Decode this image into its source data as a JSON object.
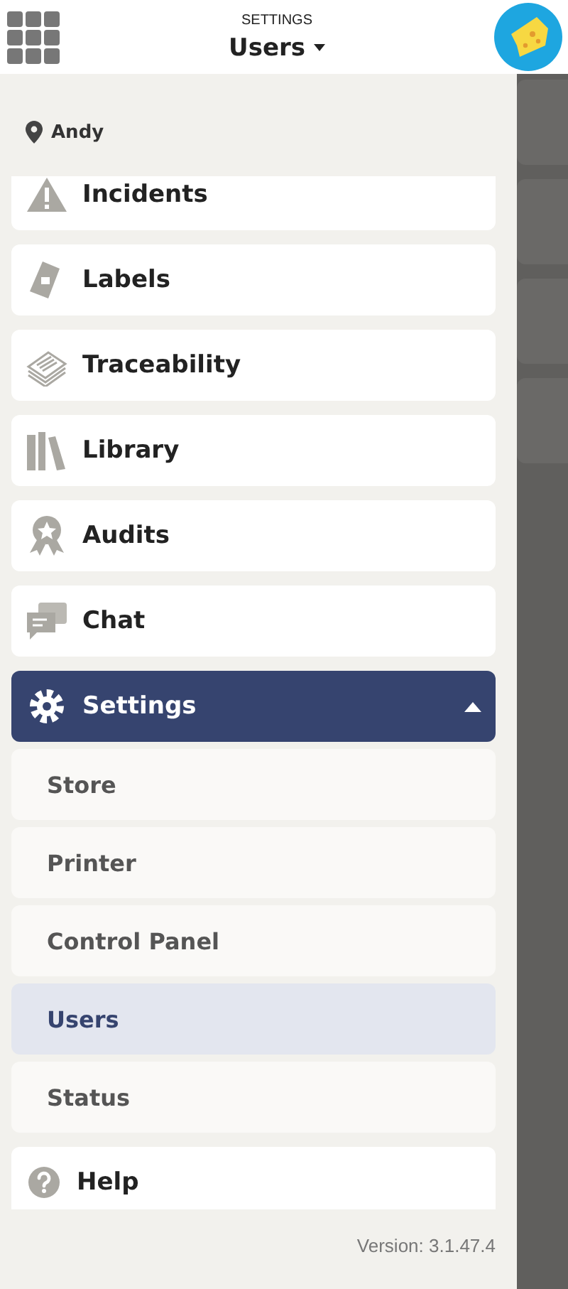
{
  "header": {
    "section": "SETTINGS",
    "title": "Users"
  },
  "location": "Andy",
  "menu": [
    {
      "label": "Incidents",
      "kind": "item"
    },
    {
      "label": "Labels",
      "kind": "item"
    },
    {
      "label": "Traceability",
      "kind": "item"
    },
    {
      "label": "Library",
      "kind": "item"
    },
    {
      "label": "Audits",
      "kind": "item"
    },
    {
      "label": "Chat",
      "kind": "item"
    },
    {
      "label": "Settings",
      "kind": "group",
      "expanded": true,
      "children": [
        {
          "label": "Store",
          "selected": false
        },
        {
          "label": "Printer",
          "selected": false
        },
        {
          "label": "Control Panel",
          "selected": false
        },
        {
          "label": "Users",
          "selected": true
        },
        {
          "label": "Status",
          "selected": false
        }
      ]
    },
    {
      "label": "Help",
      "kind": "item"
    }
  ],
  "version": "Version: 3.1.47.4"
}
